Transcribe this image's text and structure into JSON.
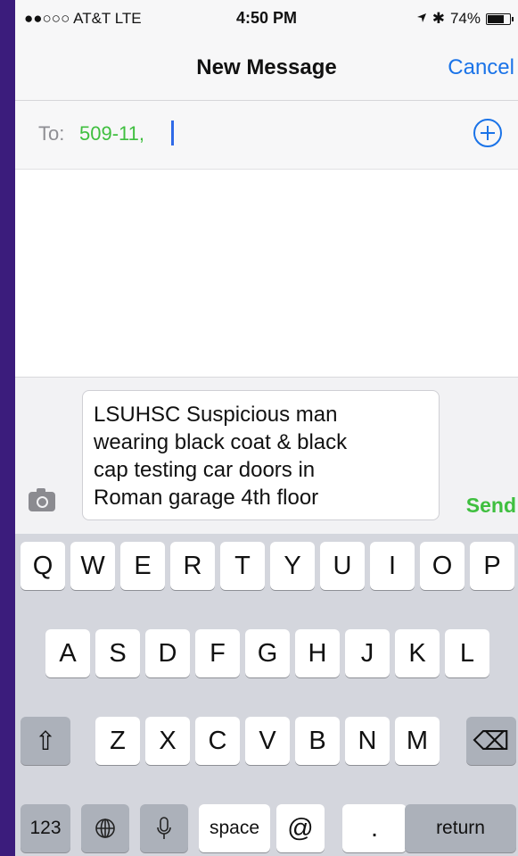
{
  "status_bar": {
    "carrier": "●●○○○ AT&T  LTE",
    "time": "4:50 PM",
    "bluetooth": "✱",
    "battery_pct": "74%",
    "battery_level": 0.74,
    "icons": [
      "location-icon",
      "bluetooth-icon",
      "battery-icon"
    ]
  },
  "nav": {
    "title": "New Message",
    "cancel_label": "Cancel"
  },
  "to_field": {
    "label": "To:",
    "recipient": "509-11,",
    "add_icon": "plus-circle-icon"
  },
  "compose": {
    "camera_icon": "camera-icon",
    "text": "LSUHSC Suspicious man\nwearing black coat & black\ncap testing car doors in\nRoman garage 4th floor",
    "send_label": "Send"
  },
  "keyboard": {
    "row1": [
      "Q",
      "W",
      "E",
      "R",
      "T",
      "Y",
      "U",
      "I",
      "O",
      "P"
    ],
    "row2": [
      "A",
      "S",
      "D",
      "F",
      "G",
      "H",
      "J",
      "K",
      "L"
    ],
    "row3": [
      "Z",
      "X",
      "C",
      "V",
      "B",
      "N",
      "M"
    ],
    "shift": "⇧",
    "delete": "⌫",
    "numbers": "123",
    "globe": "globe-icon",
    "mic": "microphone-icon",
    "space": "space",
    "at": "@",
    "period": ".",
    "return": "return"
  },
  "colors": {
    "accent": "#1a73e8",
    "green": "#3fbf3f",
    "frame": "#3b1c7c"
  }
}
